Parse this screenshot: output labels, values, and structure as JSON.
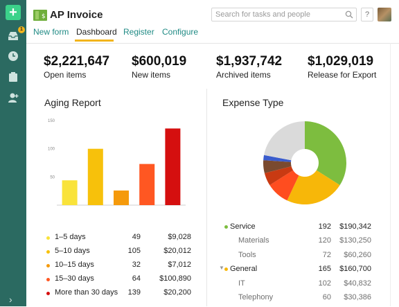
{
  "app": {
    "title": "AP Invoice",
    "help": "?"
  },
  "search": {
    "placeholder": "Search for tasks and people"
  },
  "rail": {
    "badge": "1"
  },
  "tabs": [
    {
      "label": "New form",
      "active": false
    },
    {
      "label": "Dashboard",
      "active": true
    },
    {
      "label": "Register",
      "active": false
    },
    {
      "label": "Configure",
      "active": false
    }
  ],
  "stats": [
    {
      "value": "$2,221,647",
      "label": "Open items"
    },
    {
      "value": "$600,019",
      "label": "New items"
    },
    {
      "value": "$1,937,742",
      "label": "Archived items"
    },
    {
      "value": "$1,029,019",
      "label": "Release for Export"
    }
  ],
  "aging": {
    "title": "Aging Report",
    "rows": [
      {
        "label": "1–5 days",
        "count": "49",
        "amount": "$9,028",
        "color": "#f9e33a"
      },
      {
        "label": "5–10 days",
        "count": "105",
        "amount": "$20,012",
        "color": "#f7c10b"
      },
      {
        "label": "10–15 days",
        "count": "32",
        "amount": "$7,012",
        "color": "#f59a0c"
      },
      {
        "label": "15–30 days",
        "count": "64",
        "amount": "$100,890",
        "color": "#ff5722"
      },
      {
        "label": "More than 30 days",
        "count": "139",
        "amount": "$20,200",
        "color": "#d50f0f"
      }
    ]
  },
  "chart_data": {
    "type": "bar",
    "title": "Aging Report",
    "categories": [
      "1–5 days",
      "5–10 days",
      "10–15 days",
      "15–30 days",
      "More than 30 days"
    ],
    "values": [
      44,
      100,
      26,
      73,
      136
    ],
    "colors": [
      "#f9e33a",
      "#f7c10b",
      "#f59a0c",
      "#ff5722",
      "#d50f0f"
    ],
    "ylim": [
      0,
      150
    ],
    "yticks": [
      50,
      100,
      150
    ],
    "grid": false
  },
  "expense": {
    "title": "Expense Type",
    "pie": [
      {
        "value": 34,
        "color": "#7dbd3f"
      },
      {
        "value": 23,
        "color": "#f7b709"
      },
      {
        "value": 9,
        "color": "#ff4d1f"
      },
      {
        "value": 5,
        "color": "#c93a12"
      },
      {
        "value": 5,
        "color": "#7a4a2f"
      },
      {
        "value": 2,
        "color": "#3a5ccc"
      },
      {
        "value": 22,
        "color": "#dadada"
      }
    ],
    "rows": [
      {
        "kind": "group",
        "name": "Service",
        "count": "192",
        "amount": "$190,342",
        "color": "#7dbd3f",
        "expanded": false
      },
      {
        "kind": "sub",
        "name": "Materials",
        "count": "120",
        "amount": "$130,250"
      },
      {
        "kind": "sub",
        "name": "Tools",
        "count": "72",
        "amount": "$60,260"
      },
      {
        "kind": "group",
        "name": "General",
        "count": "165",
        "amount": "$160,700",
        "color": "#f7b709",
        "expanded": true
      },
      {
        "kind": "sub",
        "name": "IT",
        "count": "102",
        "amount": "$40,832"
      },
      {
        "kind": "sub",
        "name": "Telephony",
        "count": "60",
        "amount": "$30,386"
      }
    ]
  }
}
